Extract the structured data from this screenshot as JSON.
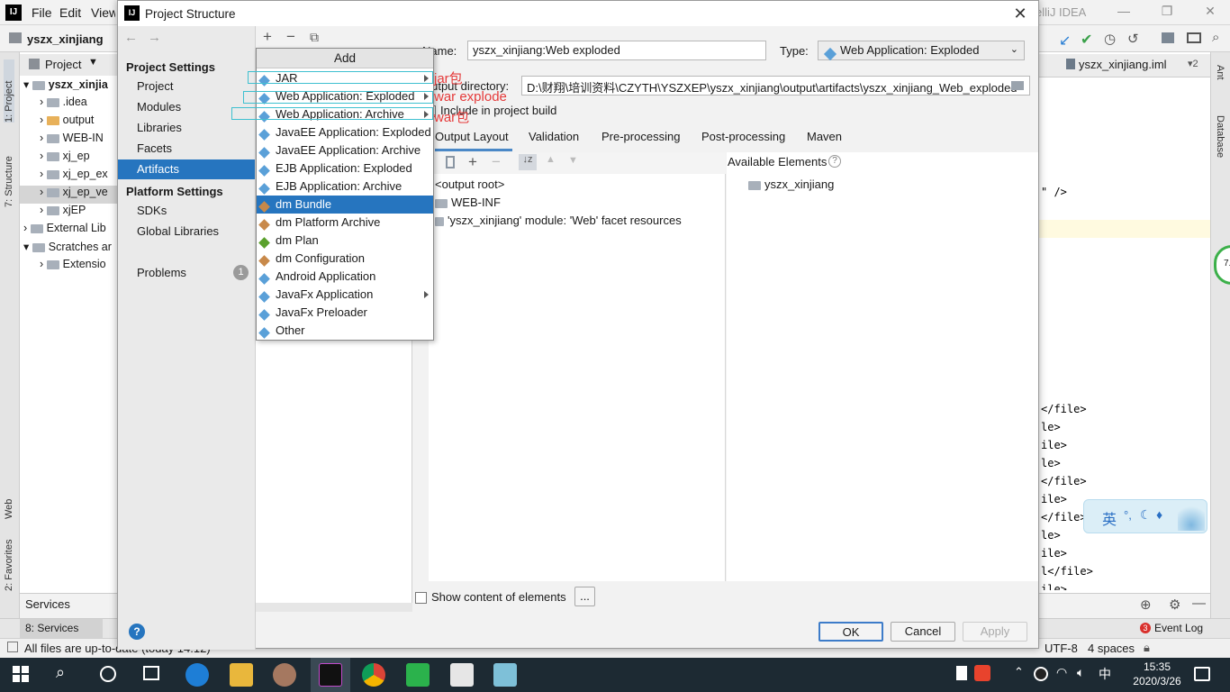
{
  "ide": {
    "menu": [
      "File",
      "Edit",
      "View"
    ],
    "title_right": "elliJ IDEA",
    "breadcrumb": "yszx_xinjiang",
    "project_panel": {
      "label": "Project",
      "tree": [
        "yszx_xinjia",
        ".idea",
        "output",
        "WEB-IN",
        "xj_ep",
        "xj_ep_ex",
        "xj_ep_ve",
        "xjEP",
        "External Lib",
        "Scratches ar",
        "Extensio"
      ]
    },
    "services_label": "Services",
    "bottom_tab": "8: Services",
    "status_text": "All files are up-to-date (today 14:12)",
    "status_right": [
      "UTF-8",
      "4 spaces"
    ],
    "event_log": "Event Log",
    "event_count": "3",
    "editor_tab": "yszx_xinjiang.iml",
    "code_lines": [
      "\" />",
      "</file>",
      "le>",
      "ile>",
      "le>",
      "</file>",
      "ile>",
      "</file>",
      "le>",
      "ile>",
      "l</file>",
      "ile>"
    ],
    "left_strip": [
      "1: Project",
      "7: Structure",
      "Web",
      "2: Favorites"
    ],
    "right_strip": [
      "Ant",
      "Database"
    ],
    "notification": "7.2"
  },
  "dialog": {
    "title": "Project Structure",
    "nav": {
      "project_settings_header": "Project Settings",
      "project_settings": [
        "Project",
        "Modules",
        "Libraries",
        "Facets",
        "Artifacts"
      ],
      "platform_settings_header": "Platform Settings",
      "platform_settings": [
        "SDKs",
        "Global Libraries"
      ],
      "problems": "Problems",
      "problems_count": "1",
      "selected": "Artifacts"
    },
    "name_label": "Name:",
    "name_value": "yszx_xinjiang:Web exploded",
    "type_label": "Type:",
    "type_value": "Web Application: Exploded",
    "output_dir_label": "Output directory:",
    "output_dir_value": "D:\\财翔\\培训资料\\CZYTH\\YSZXEP\\yszx_xinjiang\\output\\artifacts\\yszx_xinjiang_Web_exploded",
    "include_build": "Include in project build",
    "tabs": [
      "Output Layout",
      "Validation",
      "Pre-processing",
      "Post-processing",
      "Maven"
    ],
    "available_elements": "Available Elements",
    "layout_tree": [
      "<output root>",
      "WEB-INF",
      "'yszx_xinjiang' module: 'Web' facet resources"
    ],
    "available_tree": [
      "yszx_xinjiang"
    ],
    "show_content": "Show content of elements",
    "ellipsis": "...",
    "buttons": {
      "ok": "OK",
      "cancel": "Cancel",
      "apply": "Apply"
    }
  },
  "add_popup": {
    "title": "Add",
    "items": [
      {
        "label": "JAR",
        "submenu": true
      },
      {
        "label": "Web Application: Exploded",
        "submenu": true
      },
      {
        "label": "Web Application: Archive",
        "submenu": true
      },
      {
        "label": "JavaEE Application: Exploded",
        "submenu": false
      },
      {
        "label": "JavaEE Application: Archive",
        "submenu": false
      },
      {
        "label": "EJB Application: Exploded",
        "submenu": false
      },
      {
        "label": "EJB Application: Archive",
        "submenu": false
      },
      {
        "label": "dm Bundle",
        "submenu": false
      },
      {
        "label": "dm Platform Archive",
        "submenu": false
      },
      {
        "label": "dm Plan",
        "submenu": false
      },
      {
        "label": "dm Configuration",
        "submenu": false
      },
      {
        "label": "Android Application",
        "submenu": false
      },
      {
        "label": "JavaFx Application",
        "submenu": true
      },
      {
        "label": "JavaFx Preloader",
        "submenu": false
      },
      {
        "label": "Other",
        "submenu": false
      }
    ],
    "selected": "dm Bundle"
  },
  "annotations": [
    "jar包",
    "war explode",
    "war包"
  ],
  "taskbar": {
    "time": "15:35",
    "date": "2020/3/26"
  },
  "ime": {
    "text": "英"
  },
  "colors": {
    "selection": "#2675bf",
    "annotation": "#e53a3a",
    "highlight_box": "#3ec0d0",
    "taskbar": "#1d2a33"
  }
}
